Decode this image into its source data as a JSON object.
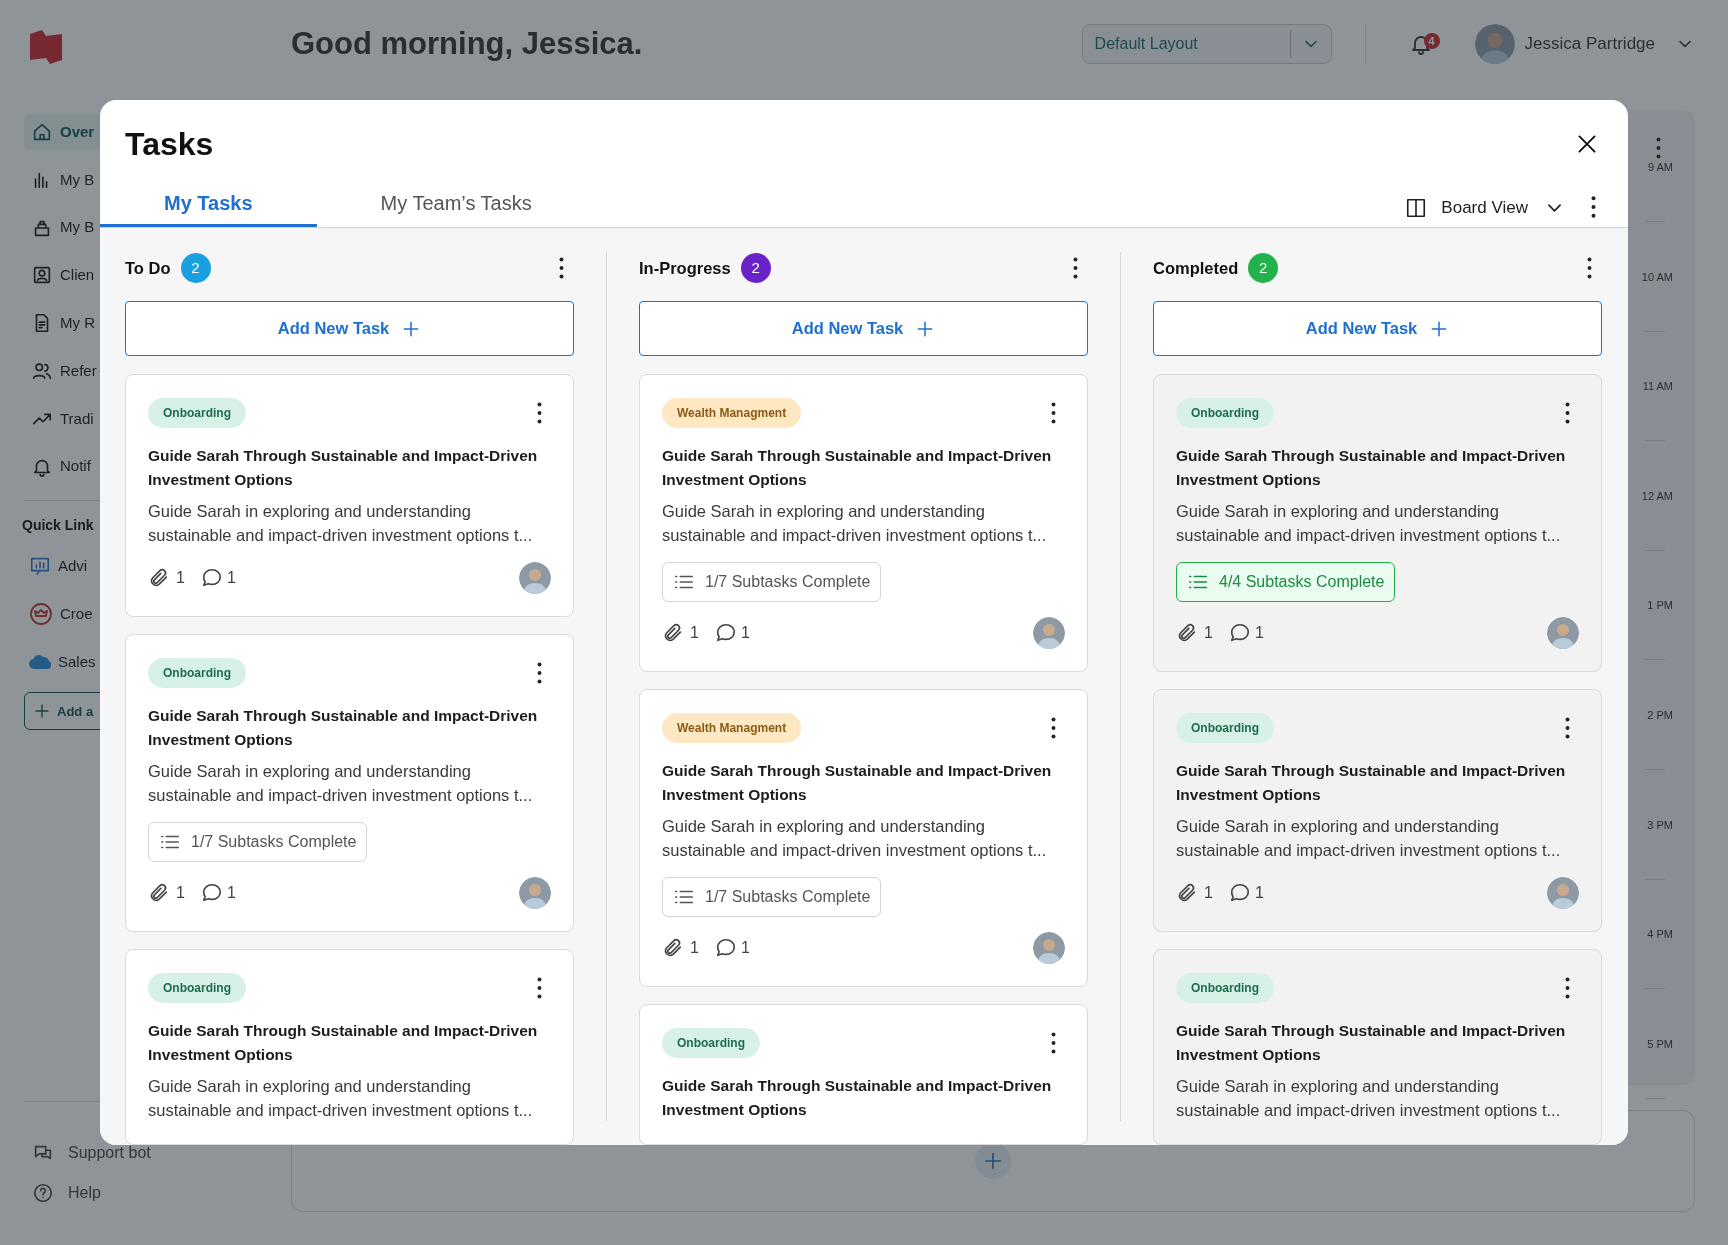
{
  "app": {
    "greeting": "Good morning, Jessica.",
    "layout_select": "Default Layout",
    "notification_count": "4",
    "user_name": "Jessica Partridge",
    "sidebar": {
      "items": [
        {
          "label": "Over",
          "selected": true
        },
        {
          "label": "My B",
          "selected": false
        },
        {
          "label": "My B",
          "selected": false
        },
        {
          "label": "Clien",
          "selected": false
        },
        {
          "label": "My R",
          "selected": false
        },
        {
          "label": "Refer",
          "selected": false
        },
        {
          "label": "Tradi",
          "selected": false
        },
        {
          "label": "Notif",
          "selected": false
        }
      ],
      "quick_links_heading": "Quick Link",
      "quick_links": [
        "Advi",
        "Croe",
        "Sales"
      ],
      "add_button": "Add a",
      "footer": [
        "Support bot",
        "Help"
      ]
    },
    "calendar": {
      "times": [
        "9 AM",
        "10 AM",
        "11 AM",
        "12 AM",
        "1 PM",
        "2 PM",
        "3 PM",
        "4 PM",
        "5 PM"
      ]
    }
  },
  "modal": {
    "title": "Tasks",
    "tabs": [
      {
        "label": "My Tasks",
        "selected": true
      },
      {
        "label": "My Team’s Tasks",
        "selected": false
      }
    ],
    "view_select": "Board View",
    "columns": [
      {
        "title": "To Do",
        "count": "2",
        "color": "#1a9fe0",
        "kind": "open",
        "add_button": "Add New Task",
        "cards": [
          {
            "tag": {
              "label": "Onboarding",
              "kind": "green"
            },
            "title": "Guide Sarah Through Sustainable and Impact-Driven Investment Options",
            "description": [
              "Guide Sarah in exploring and understanding",
              "sustainable and impact-driven investment options t..."
            ],
            "attachments": "1",
            "comments": "1"
          },
          {
            "tag": {
              "label": "Onboarding",
              "kind": "green"
            },
            "title": "Guide Sarah Through Sustainable and Impact-Driven Investment Options",
            "description": [
              "Guide Sarah in exploring and understanding",
              "sustainable and impact-driven investment options t..."
            ],
            "subtasks": {
              "text": "1/7 Subtasks Complete",
              "done": false
            },
            "attachments": "1",
            "comments": "1"
          },
          {
            "tag": {
              "label": "Onboarding",
              "kind": "green"
            },
            "title": "Guide Sarah Through Sustainable and Impact-Driven Investment Options",
            "description": [
              "Guide Sarah in exploring and understanding",
              "sustainable and impact-driven investment options t..."
            ]
          }
        ]
      },
      {
        "title": "In-Progress",
        "count": "2",
        "color": "#6a22c9",
        "kind": "open",
        "add_button": "Add New Task",
        "cards": [
          {
            "tag": {
              "label": "Wealth Managment",
              "kind": "amber"
            },
            "title": "Guide Sarah Through Sustainable and Impact-Driven Investment Options",
            "description": [
              "Guide Sarah in exploring and understanding",
              "sustainable and impact-driven investment options t..."
            ],
            "subtasks": {
              "text": "1/7 Subtasks Complete",
              "done": false
            },
            "attachments": "1",
            "comments": "1"
          },
          {
            "tag": {
              "label": "Wealth Managment",
              "kind": "amber"
            },
            "title": "Guide Sarah Through Sustainable and Impact-Driven Investment Options",
            "description": [
              "Guide Sarah in exploring and understanding",
              "sustainable and impact-driven investment options t..."
            ],
            "subtasks": {
              "text": "1/7 Subtasks Complete",
              "done": false
            },
            "attachments": "1",
            "comments": "1"
          },
          {
            "tag": {
              "label": "Onboarding",
              "kind": "green"
            },
            "title": "Guide Sarah Through Sustainable and Impact-Driven Investment Options"
          }
        ]
      },
      {
        "title": "Completed",
        "count": "2",
        "color": "#21b24b",
        "kind": "completed",
        "add_button": "Add New Task",
        "cards": [
          {
            "tag": {
              "label": "Onboarding",
              "kind": "green"
            },
            "title": "Guide Sarah Through Sustainable and Impact-Driven Investment Options",
            "description": [
              "Guide Sarah in exploring and understanding",
              "sustainable and impact-driven investment options t..."
            ],
            "subtasks": {
              "text": "4/4 Subtasks Complete",
              "done": true
            },
            "attachments": "1",
            "comments": "1"
          },
          {
            "tag": {
              "label": "Onboarding",
              "kind": "green"
            },
            "title": "Guide Sarah Through Sustainable and Impact-Driven Investment Options",
            "description": [
              "Guide Sarah in exploring and understanding",
              "sustainable and impact-driven investment options t..."
            ],
            "attachments": "1",
            "comments": "1"
          },
          {
            "tag": {
              "label": "Onboarding",
              "kind": "green"
            },
            "title": "Guide Sarah Through Sustainable and Impact-Driven Investment Options",
            "description": [
              "Guide Sarah in exploring and understanding",
              "sustainable and impact-driven investment options t..."
            ]
          }
        ]
      }
    ]
  }
}
